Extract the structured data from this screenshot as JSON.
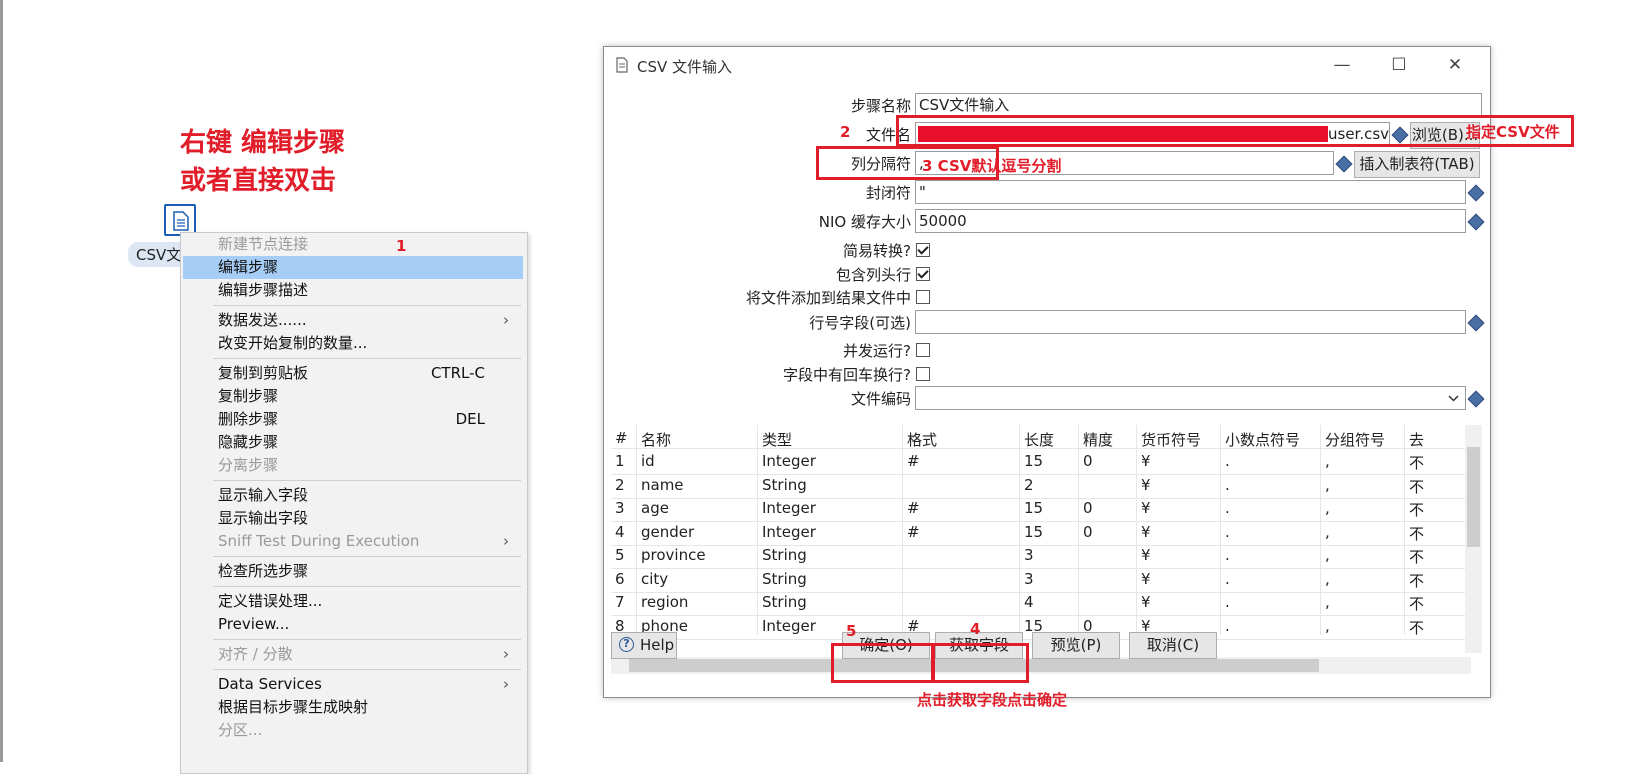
{
  "annotations": {
    "title_line1": "右键 编辑步骤",
    "title_line2": "或者直接双击",
    "n1": "1",
    "n2": "2",
    "n3": "3 CSV默认逗号分割",
    "n4": "4",
    "n5": "5",
    "file_hint": "指定CSV文件",
    "bottom_hint": "点击获取字段点击确定"
  },
  "canvas": {
    "step_label": "CSV文"
  },
  "menu": {
    "items": [
      {
        "label": "新建节点连接",
        "disabled": true
      },
      {
        "label": "编辑步骤",
        "selected": true
      },
      {
        "label": "编辑步骤描述"
      },
      {
        "label": "数据发送......",
        "arrow": "›"
      },
      {
        "label": "改变开始复制的数量..."
      },
      {
        "label": "复制到剪贴板",
        "shortcut": "CTRL-C"
      },
      {
        "label": "复制步骤"
      },
      {
        "label": "删除步骤",
        "shortcut": "DEL"
      },
      {
        "label": "隐藏步骤"
      },
      {
        "label": "分离步骤",
        "disabled": true
      },
      {
        "label": "显示输入字段"
      },
      {
        "label": "显示输出字段"
      },
      {
        "label": "Sniff Test During Execution",
        "disabled": true,
        "arrow": "›"
      },
      {
        "label": "检查所选步骤"
      },
      {
        "label": "定义错误处理..."
      },
      {
        "label": "Preview..."
      },
      {
        "label": "对齐 / 分散",
        "disabled": true,
        "arrow": "›"
      },
      {
        "label": "Data Services",
        "arrow": "›"
      },
      {
        "label": "根据目标步骤生成映射"
      },
      {
        "label": "分区...",
        "disabled": true
      }
    ]
  },
  "dialog": {
    "title": "CSV 文件输入",
    "window_buttons": {
      "minimize": "—",
      "maximize": "☐",
      "close": "✕"
    },
    "fields": {
      "step_name_label": "步骤名称",
      "step_name_value": "CSV文件输入",
      "filename_label": "文件名",
      "filename_value": "user.csv",
      "delimiter_label": "列分隔符",
      "delimiter_value": ",",
      "enclosure_label": "封闭符",
      "enclosure_value": "\"",
      "nio_label": "NIO 缓存大小",
      "nio_value": "50000",
      "lazy_label": "简易转换?",
      "header_label": "包含列头行",
      "addfile_label": "将文件添加到结果文件中",
      "rownum_label": "行号字段(可选)",
      "parallel_label": "并发运行?",
      "newline_label": "字段中有回车换行?",
      "encoding_label": "文件编码"
    },
    "checks": {
      "lazy": true,
      "header": true,
      "addfile": false,
      "parallel": false,
      "newline": false
    },
    "browse_button": "浏览(B)...",
    "tab_button": "插入制表符(TAB)",
    "table": {
      "headers": [
        "#",
        "名称",
        "类型",
        "格式",
        "长度",
        "精度",
        "货币符号",
        "小数点符号",
        "分组符号",
        "去"
      ],
      "rows": [
        [
          "1",
          "id",
          "Integer",
          "#",
          "15",
          "0",
          "¥",
          ".",
          ",",
          "不"
        ],
        [
          "2",
          "name",
          "String",
          "",
          "2",
          "",
          "¥",
          ".",
          ",",
          "不"
        ],
        [
          "3",
          "age",
          "Integer",
          "#",
          "15",
          "0",
          "¥",
          ".",
          ",",
          "不"
        ],
        [
          "4",
          "gender",
          "Integer",
          "#",
          "15",
          "0",
          "¥",
          ".",
          ",",
          "不"
        ],
        [
          "5",
          "province",
          "String",
          "",
          "3",
          "",
          "¥",
          ".",
          ",",
          "不"
        ],
        [
          "6",
          "city",
          "String",
          "",
          "3",
          "",
          "¥",
          ".",
          ",",
          "不"
        ],
        [
          "7",
          "region",
          "String",
          "",
          "4",
          "",
          "¥",
          ".",
          ",",
          "不"
        ],
        [
          "8",
          "phone",
          "Integer",
          "#",
          "15",
          "0",
          "¥",
          ".",
          ",",
          "不"
        ]
      ]
    },
    "buttons": {
      "help": "Help",
      "ok": "确定(O)",
      "get_fields": "获取字段",
      "preview": "预览(P)",
      "cancel": "取消(C)"
    }
  }
}
